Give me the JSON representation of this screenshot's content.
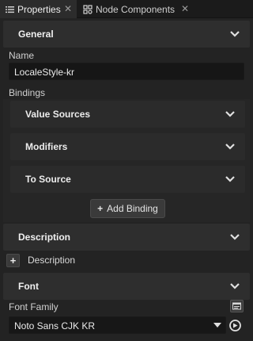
{
  "tabs": [
    {
      "label": "Properties",
      "icon": "list-icon",
      "close": "✕"
    },
    {
      "label": "Node Components",
      "icon": "components-icon",
      "close": "✕"
    }
  ],
  "general": {
    "title": "General",
    "name_label": "Name",
    "name_value": "LocaleStyle-kr",
    "bindings_label": "Bindings",
    "value_sources": "Value Sources",
    "modifiers": "Modifiers",
    "to_source": "To Source",
    "add_binding": "Add Binding",
    "add_plus": "+"
  },
  "description": {
    "title": "Description",
    "add_plus": "+",
    "label": "Description"
  },
  "font": {
    "title": "Font",
    "family_label": "Font Family",
    "family_value": "Noto Sans CJK KR"
  },
  "colors": {
    "background": "#232323",
    "header": "#2e2e2e",
    "input": "#161616",
    "text": "#d8d8d8"
  }
}
